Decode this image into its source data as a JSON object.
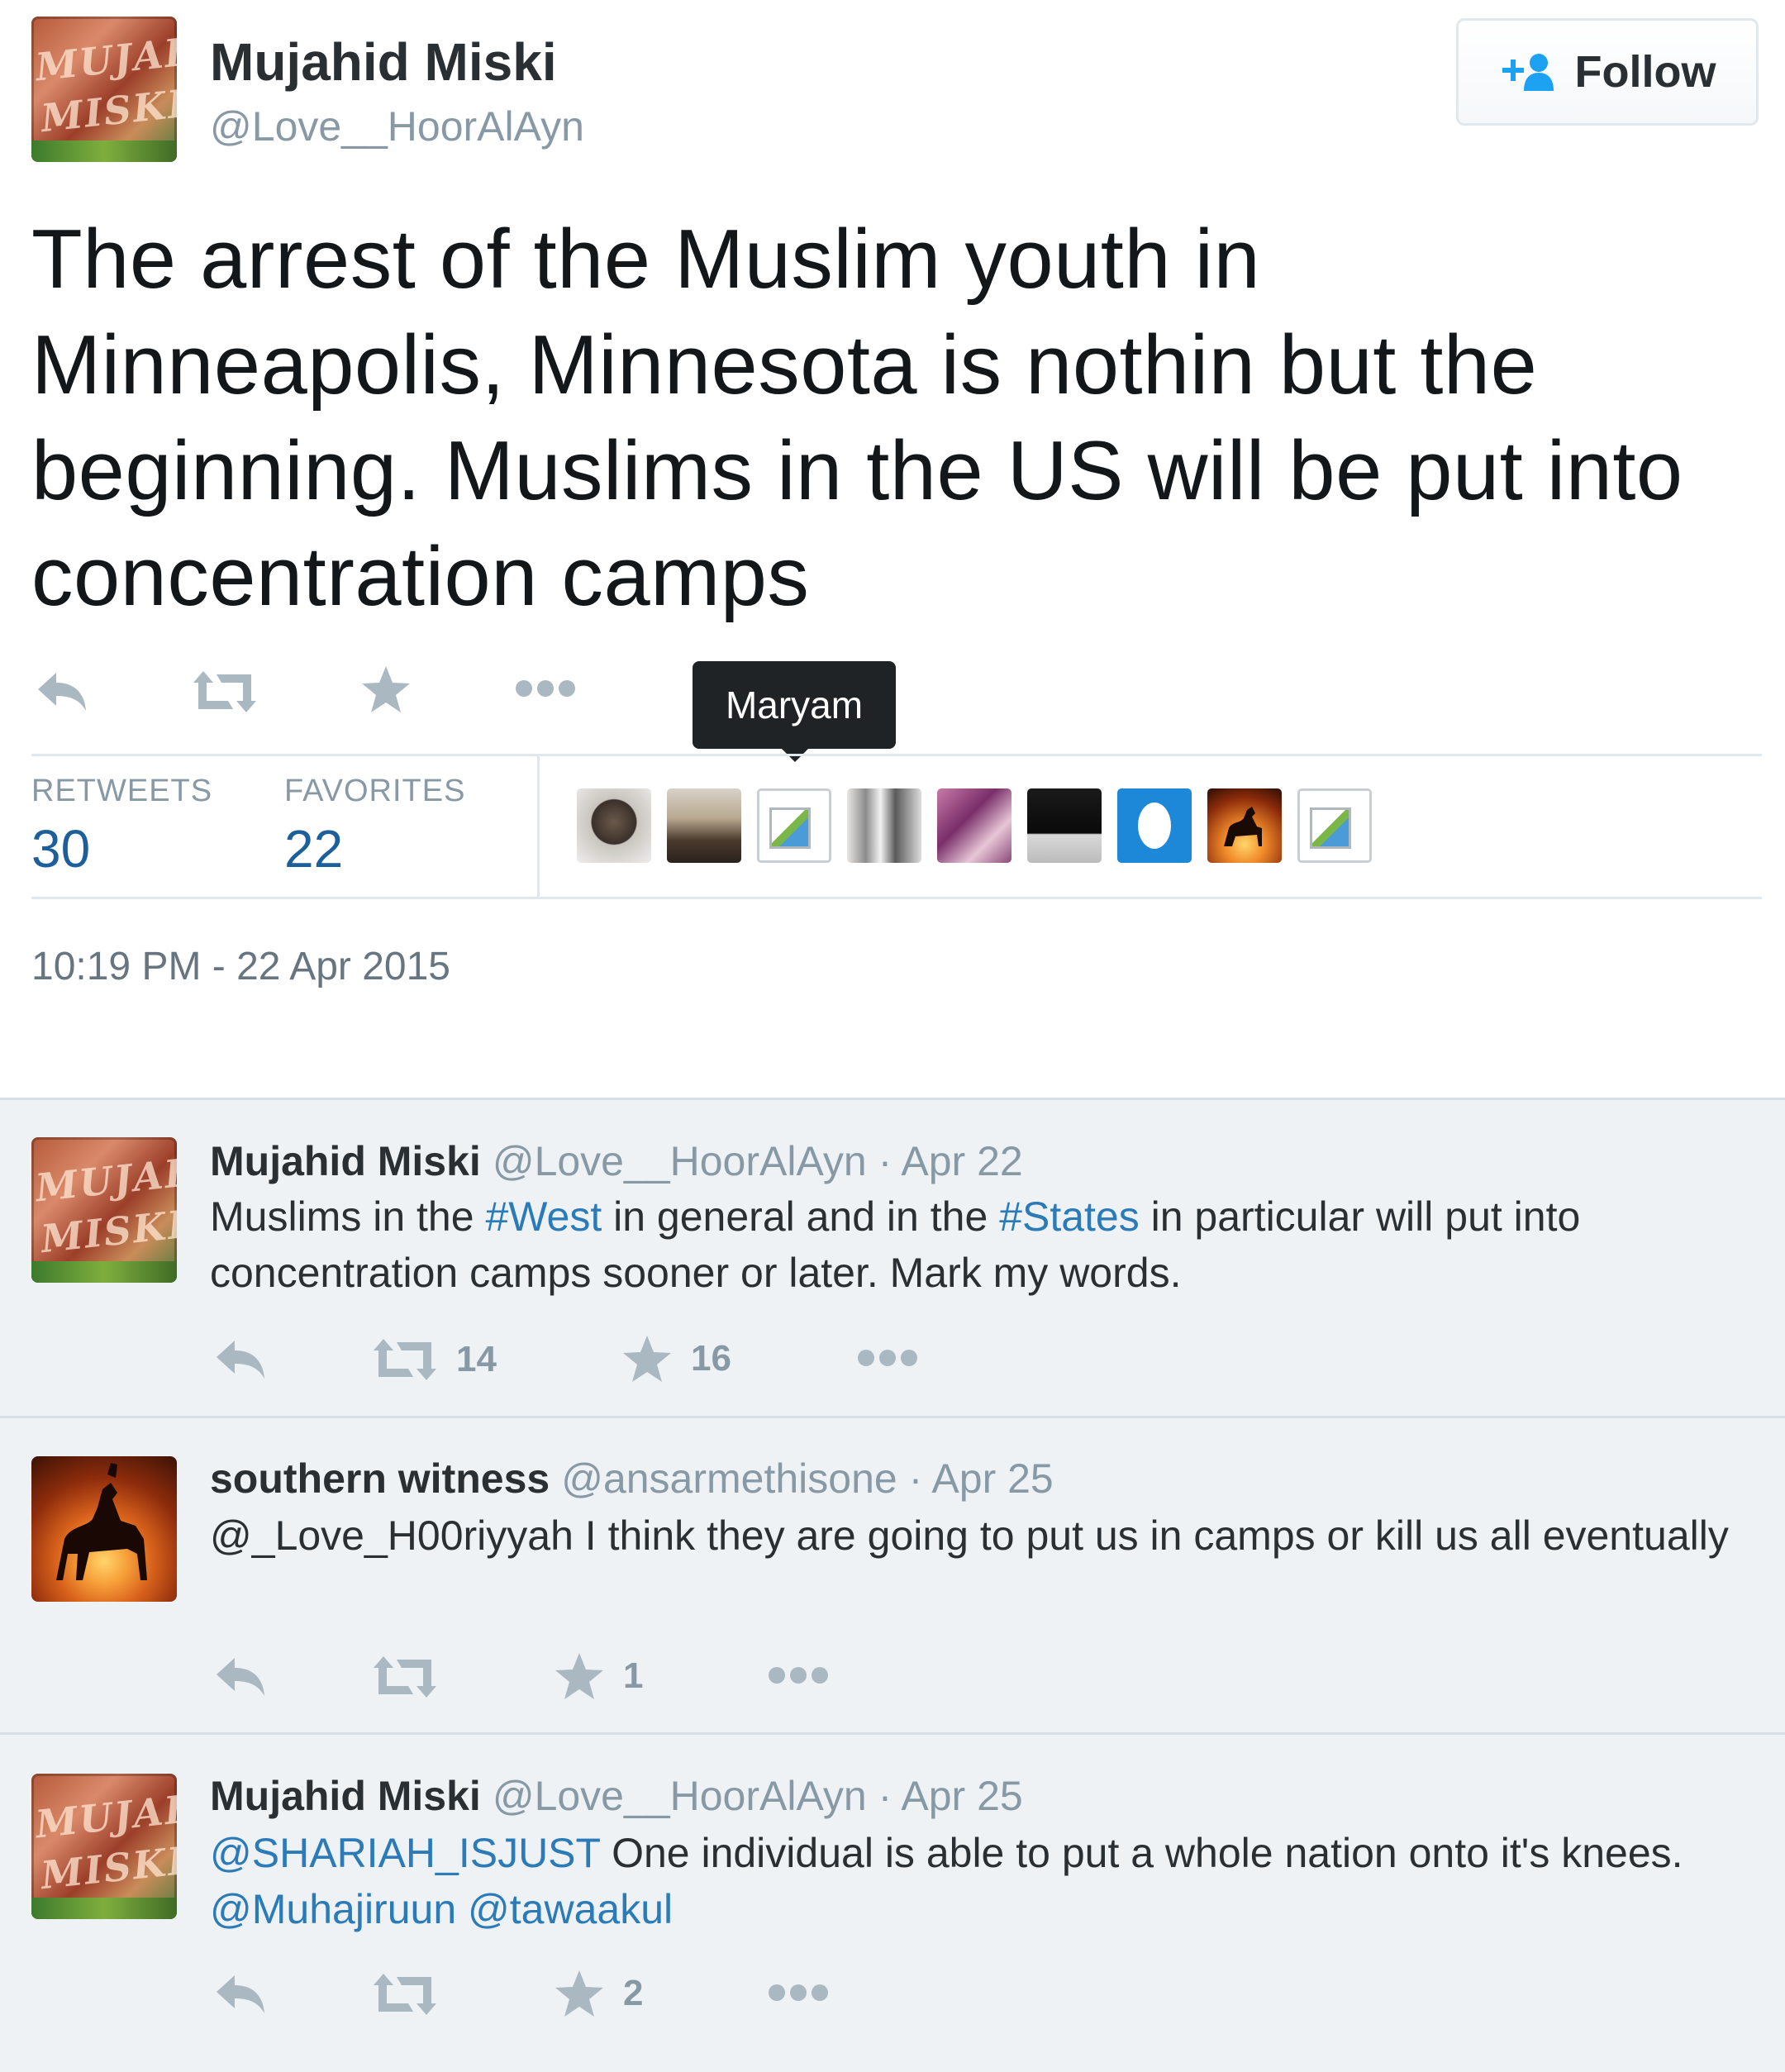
{
  "main_tweet": {
    "user": {
      "name": "Mujahid Miski",
      "handle": "@Love__HoorAlAyn"
    },
    "follow_label": "Follow",
    "text": "The arrest of the Muslim youth in Minneapolis, Minnesota is nothin but the beginning. Muslims in the US will be put into concentration camps",
    "tooltip": "Maryam",
    "stats": {
      "retweets_label": "RETWEETS",
      "retweets": "30",
      "favorites_label": "FAVORITES",
      "favorites": "22"
    },
    "timestamp": "10:19 PM - 22 Apr 2015"
  },
  "replies": [
    {
      "name": "Mujahid Miski",
      "handle": "@Love__HoorAlAyn",
      "date": "· Apr 22",
      "text_parts": [
        "Muslims in the ",
        "#West",
        " in general and in the ",
        "#States",
        " in particular will put into concentration camps sooner or later. Mark my words."
      ],
      "retweets": "14",
      "favorites": "16"
    },
    {
      "name": "southern witness",
      "handle": "@ansarmethisone",
      "date": "· Apr 25",
      "text": "@_Love_H00riyyah I think they are going to put us in camps or kill us all eventually",
      "retweets": "",
      "favorites": "1"
    },
    {
      "name": "Mujahid Miski",
      "handle": "@Love__HoorAlAyn",
      "date": "· Apr 25",
      "text_parts": [
        "@SHARIAH_ISJUST",
        " One individual is able to put a whole nation onto it's knees.  ",
        "@Muhajiruun",
        " ",
        "@tawaakul"
      ],
      "retweets": "",
      "favorites": "2"
    }
  ],
  "colors": {
    "link": "#2b7bb9",
    "stat_value": "#1d5f9a",
    "muted": "#8899a6",
    "reply_bg": "#eef2f5"
  },
  "icons": [
    "reply-icon",
    "retweet-icon",
    "favorite-star-icon",
    "more-dots-icon",
    "add-user-icon"
  ]
}
